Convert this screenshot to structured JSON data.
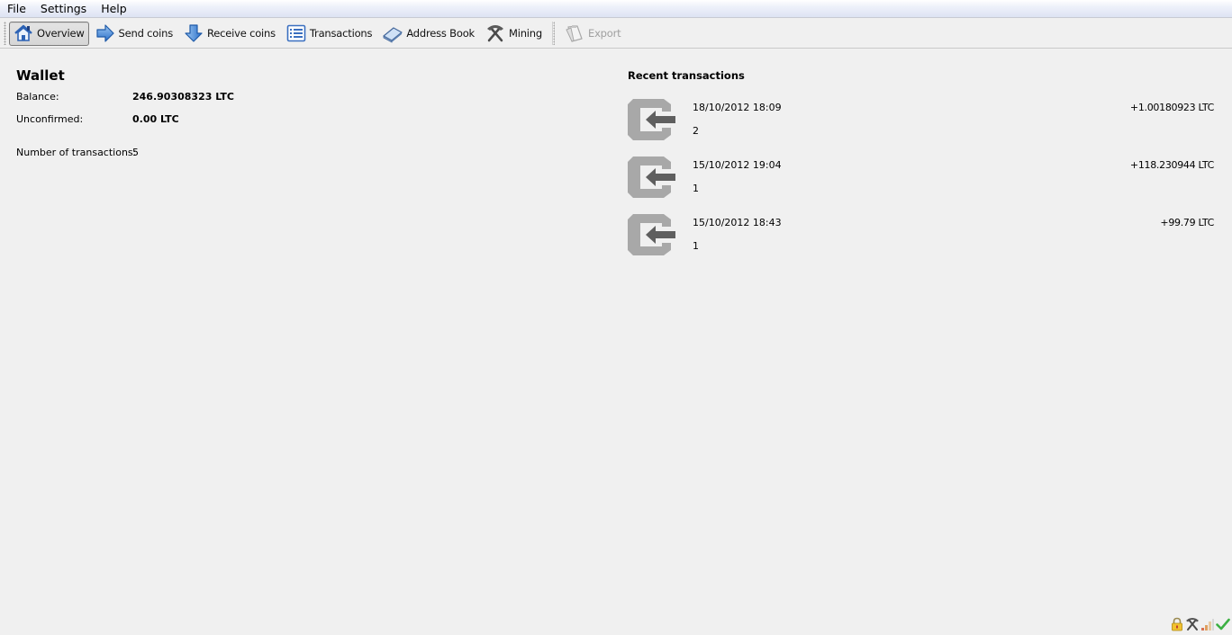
{
  "menubar": {
    "items": [
      {
        "label": "File"
      },
      {
        "label": "Settings"
      },
      {
        "label": "Help"
      }
    ]
  },
  "toolbar": {
    "overview": {
      "label": "Overview",
      "icon": "home-icon",
      "active": true
    },
    "send_coins": {
      "label": "Send coins",
      "icon": "arrow-right-icon"
    },
    "receive_coins": {
      "label": "Receive coins",
      "icon": "arrow-down-icon"
    },
    "transactions": {
      "label": "Transactions",
      "icon": "list-icon"
    },
    "address_book": {
      "label": "Address Book",
      "icon": "address-book-icon"
    },
    "mining": {
      "label": "Mining",
      "icon": "pickaxe-icon"
    },
    "export": {
      "label": "Export",
      "icon": "export-icon",
      "disabled": true
    }
  },
  "wallet": {
    "title": "Wallet",
    "balance_label": "Balance:",
    "balance_value": "246.90308323 LTC",
    "unconfirmed_label": "Unconfirmed:",
    "unconfirmed_value": "0.00 LTC",
    "num_tx_label": "Number of transactions:",
    "num_tx_value": "5"
  },
  "recent": {
    "title": "Recent transactions",
    "items": [
      {
        "date": "18/10/2012 18:09",
        "confirmations": "2",
        "amount": "+1.00180923 LTC",
        "icon": "incoming-transaction-icon"
      },
      {
        "date": "15/10/2012 19:04",
        "confirmations": "1",
        "amount": "+118.230944 LTC",
        "icon": "incoming-transaction-icon"
      },
      {
        "date": "15/10/2012 18:43",
        "confirmations": "1",
        "amount": "+99.79 LTC",
        "icon": "incoming-transaction-icon"
      }
    ]
  },
  "statusbar": {
    "icons": [
      "lock-icon",
      "mining-status-icon",
      "connections-icon",
      "synced-check-icon"
    ]
  },
  "colors": {
    "background": "#f0f0f0",
    "tx_icon_gray": "#a8a8a8",
    "tx_arrow": "#5f5f5f",
    "check_green": "#3cb043"
  }
}
